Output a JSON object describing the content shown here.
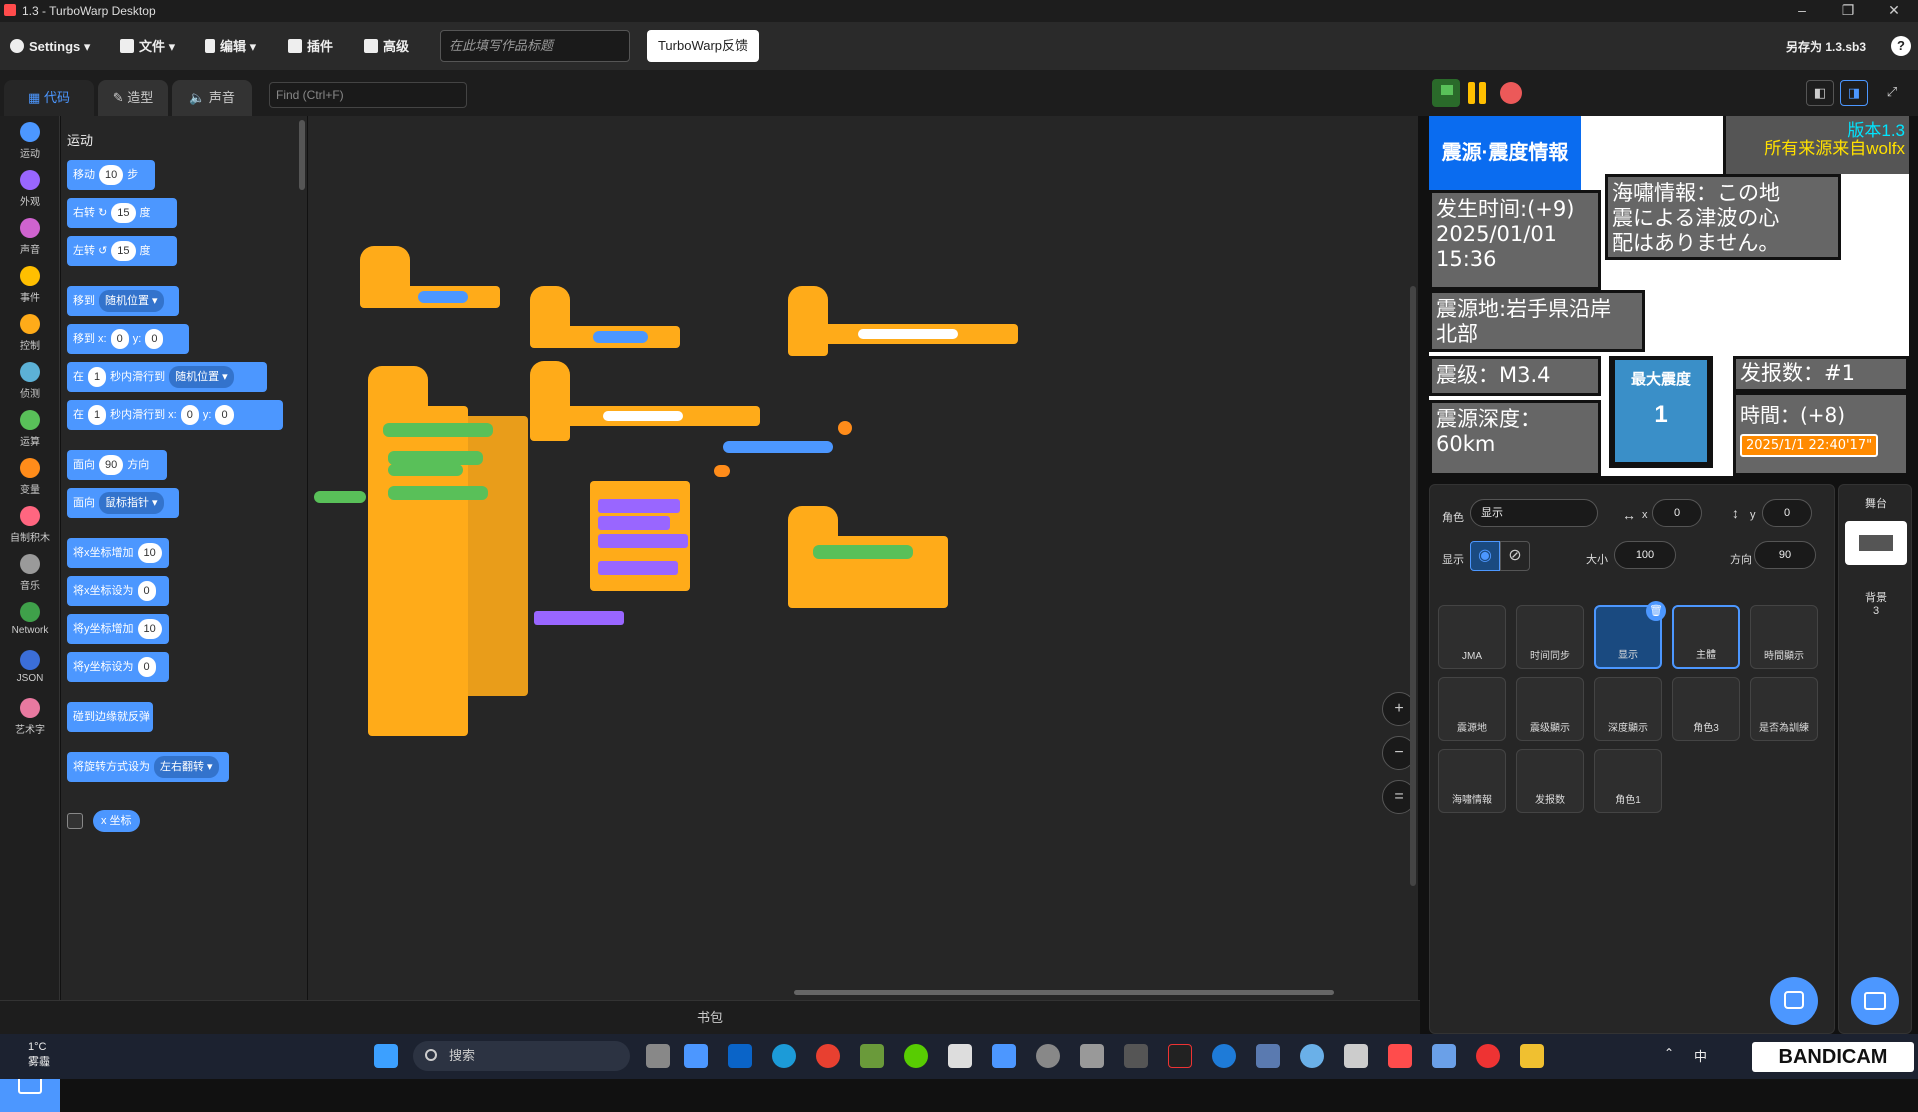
{
  "window": {
    "title": "1.3 - TurboWarp Desktop"
  },
  "menubar": {
    "settings": "Settings",
    "file": "文件",
    "edit": "编辑",
    "addons": "插件",
    "advanced": "高级",
    "title_placeholder": "在此填写作品标题",
    "feedback": "TurboWarp反馈",
    "save_as": "另存为 1.3.sb3",
    "help": "?"
  },
  "tabs": {
    "code": "代码",
    "costumes": "造型",
    "sounds": "声音",
    "find_placeholder": "Find (Ctrl+F)"
  },
  "categories": [
    {
      "label": "运动",
      "color": "#4c97ff"
    },
    {
      "label": "外观",
      "color": "#9966ff"
    },
    {
      "label": "声音",
      "color": "#cf63cf"
    },
    {
      "label": "事件",
      "color": "#ffbf00"
    },
    {
      "label": "控制",
      "color": "#ffab19"
    },
    {
      "label": "侦测",
      "color": "#5cb1d6"
    },
    {
      "label": "运算",
      "color": "#59c059"
    },
    {
      "label": "变量",
      "color": "#ff8c1a"
    },
    {
      "label": "自制积木",
      "color": "#ff6680"
    },
    {
      "label": "音乐",
      "color": "#9a9a9a"
    },
    {
      "label": "Network",
      "color": "#3fa04a"
    },
    {
      "label": "JSON",
      "color": "#3b6ed8"
    },
    {
      "label": "艺术字",
      "color": "#e879a0"
    }
  ],
  "palette": {
    "section": "运动",
    "move": {
      "pre": "移动",
      "val": "10",
      "post": "步"
    },
    "turn_right": {
      "pre": "右转",
      "val": "15",
      "post": "度"
    },
    "turn_left": {
      "pre": "左转",
      "val": "15",
      "post": "度"
    },
    "goto": {
      "pre": "移到",
      "dd": "随机位置"
    },
    "goto_xy": {
      "pre": "移到 x:",
      "x": "0",
      "mid": "y:",
      "y": "0"
    },
    "glide": {
      "pre": "在",
      "val": "1",
      "mid": "秒内滑行到",
      "dd": "随机位置"
    },
    "glide_xy": {
      "pre": "在",
      "val": "1",
      "mid": "秒内滑行到 x:",
      "x": "0",
      "mid2": "y:",
      "y": "0"
    },
    "point_dir": {
      "pre": "面向",
      "val": "90",
      "post": "方向"
    },
    "point_towards": {
      "pre": "面向",
      "dd": "鼠标指针"
    },
    "change_x": {
      "pre": "将x坐标增加",
      "val": "10"
    },
    "set_x": {
      "pre": "将x坐标设为",
      "val": "0"
    },
    "change_y": {
      "pre": "将y坐标增加",
      "val": "10"
    },
    "set_y": {
      "pre": "将y坐标设为",
      "val": "0"
    },
    "bounce": "碰到边缘就反弹",
    "rot_style": {
      "pre": "将旋转方式设为",
      "dd": "左右翻转"
    },
    "x_pos": "x 坐标"
  },
  "backpack": "书包",
  "stage": {
    "title": "震源·震度情報",
    "version": "版本1.3",
    "source": "所有来源来自wolfx",
    "time": "发生时间:(+9)\n2025/01/01\n15:36",
    "tsunami": "海嘯情報：この地\n震による津波の心\n配はありません。",
    "epicenter": "震源地:岩手県沿岸\n北部",
    "magnitude": "震级：M3.4",
    "max_intensity_label": "最大震度",
    "max_intensity": "1",
    "report_count": "发报数：#1",
    "depth": "震源深度：\n60km",
    "local_time_label": "時間：(+8)",
    "local_time": "2025/1/1 22:40'17\""
  },
  "sprite_info": {
    "sprite_label": "角色",
    "sprite_name": "显示",
    "x_label": "x",
    "x": "0",
    "y_label": "y",
    "y": "0",
    "show_label": "显示",
    "size_label": "大小",
    "size": "100",
    "dir_label": "方向",
    "direction": "90"
  },
  "sprites": [
    "JMA",
    "时间同步",
    "显示",
    "主體",
    "時間顯示",
    "震源地",
    "震级顯示",
    "深度顯示",
    "角色3",
    "是否為訓練",
    "海嘯情報",
    "发报数",
    "角色1"
  ],
  "stage_pane": {
    "label": "舞台",
    "backdrops_label": "背景",
    "backdrops": "3"
  },
  "taskbar": {
    "temp": "1°C",
    "weather": "雾霾",
    "search": "搜索",
    "ime": "中",
    "recorder": "BANDICAM"
  }
}
